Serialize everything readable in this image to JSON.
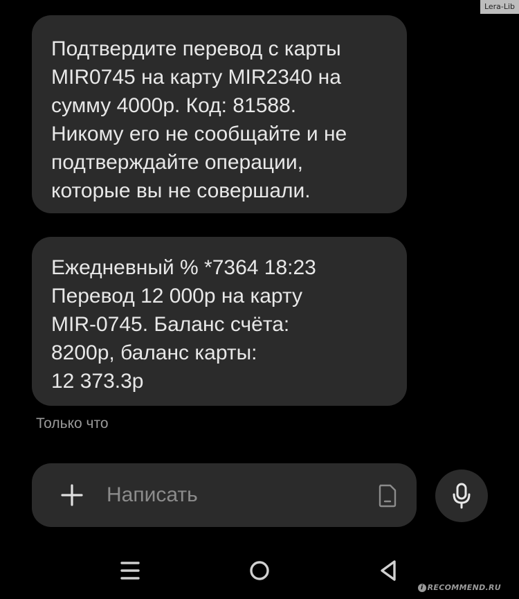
{
  "conversation": {
    "messages": [
      {
        "text": "Подтвердите перевод с карты\nMIR0745 на карту MIR2340 на\nсумму 4000р. Код: 81588.\nНикому его не сообщайте и не\nподтверждайте операции,\nкоторые вы не совершали."
      },
      {
        "text": "Ежедневный % *7364 18:23\nПеревод 12 000р на карту\nMIR-0745. Баланс счёта:\n8200р, баланс карты:\n12 373.3р"
      }
    ],
    "timestamp": "Только что"
  },
  "composer": {
    "placeholder": "Написать",
    "value": "",
    "attach_icon": "plus-icon",
    "sticker_icon": "sticker-icon",
    "mic_icon": "microphone-icon"
  },
  "navigation": {
    "menu_icon": "recent-apps-icon",
    "home_icon": "home-icon",
    "back_icon": "back-icon"
  },
  "watermarks": {
    "top": "Lera-Lib",
    "bottom": "RECOMMEND.RU",
    "bottom_badge": "i"
  },
  "colors": {
    "background": "#000000",
    "bubble": "#2b2b2b",
    "text": "#e8e8e8",
    "muted": "#9a9a9a"
  }
}
